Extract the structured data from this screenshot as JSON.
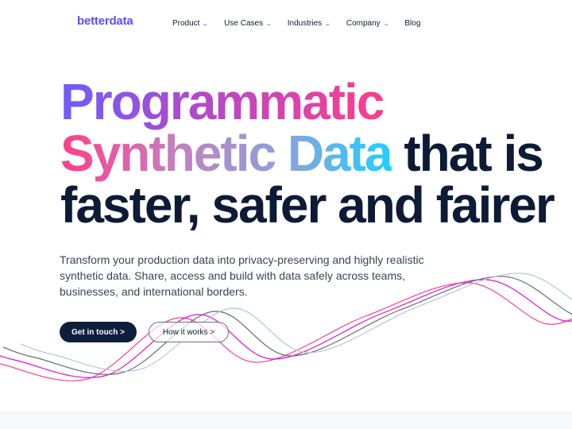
{
  "brand": {
    "logo": "betterdata",
    "color": "#5b4dff"
  },
  "nav": {
    "items": [
      {
        "label": "Product",
        "dropdown": true
      },
      {
        "label": "Use Cases",
        "dropdown": true
      },
      {
        "label": "Industries",
        "dropdown": true
      },
      {
        "label": "Company",
        "dropdown": true
      },
      {
        "label": "Blog",
        "dropdown": false
      }
    ]
  },
  "hero": {
    "title_part1": "Programmatic",
    "title_part2": "Synthetic Data",
    "title_part3": " that is",
    "title_line3": "faster, safer and fairer",
    "subtitle": "Transform your production data into privacy-preserving and highly realistic synthetic data. Share, access and build with data safely across teams, businesses, and international borders.",
    "primary_button": "Get in touch >",
    "secondary_button": "How it works >"
  },
  "colors": {
    "text": "#0d1b36",
    "wave": [
      "#ff3d8b",
      "#e010d0",
      "#666a72",
      "#b8c4d4"
    ]
  }
}
